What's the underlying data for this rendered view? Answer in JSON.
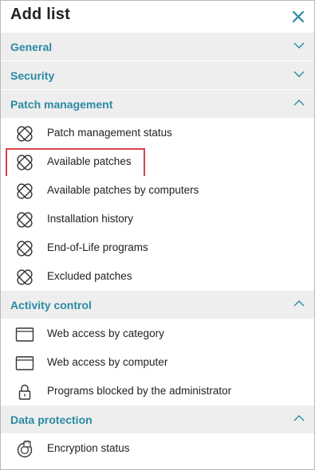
{
  "header": {
    "title": "Add list",
    "close_icon": "close-icon"
  },
  "colors": {
    "accent": "#2a8aa3",
    "section_bg": "#eeeeee",
    "highlight": "#d9414a"
  },
  "sections": [
    {
      "title": "General",
      "expanded": false,
      "chevron": "chevron-down-icon"
    },
    {
      "title": "Security",
      "expanded": false,
      "chevron": "chevron-down-icon"
    },
    {
      "title": "Patch management",
      "expanded": true,
      "chevron": "chevron-up-icon",
      "items": [
        {
          "label": "Patch management status",
          "icon": "patch-icon"
        },
        {
          "label": "Available patches",
          "icon": "patch-icon",
          "highlighted": true
        },
        {
          "label": "Available patches by computers",
          "icon": "patch-icon"
        },
        {
          "label": "Installation history",
          "icon": "patch-icon"
        },
        {
          "label": "End-of-Life programs",
          "icon": "patch-icon"
        },
        {
          "label": "Excluded patches",
          "icon": "patch-icon"
        }
      ]
    },
    {
      "title": "Activity control",
      "expanded": true,
      "chevron": "chevron-up-icon",
      "items": [
        {
          "label": "Web access by category",
          "icon": "browser-window-icon"
        },
        {
          "label": "Web access by computer",
          "icon": "browser-window-icon"
        },
        {
          "label": "Programs blocked by the administrator",
          "icon": "lock-icon"
        }
      ]
    },
    {
      "title": "Data protection",
      "expanded": true,
      "chevron": "chevron-up-icon",
      "items": [
        {
          "label": "Encryption status",
          "icon": "encryption-icon"
        }
      ]
    }
  ]
}
